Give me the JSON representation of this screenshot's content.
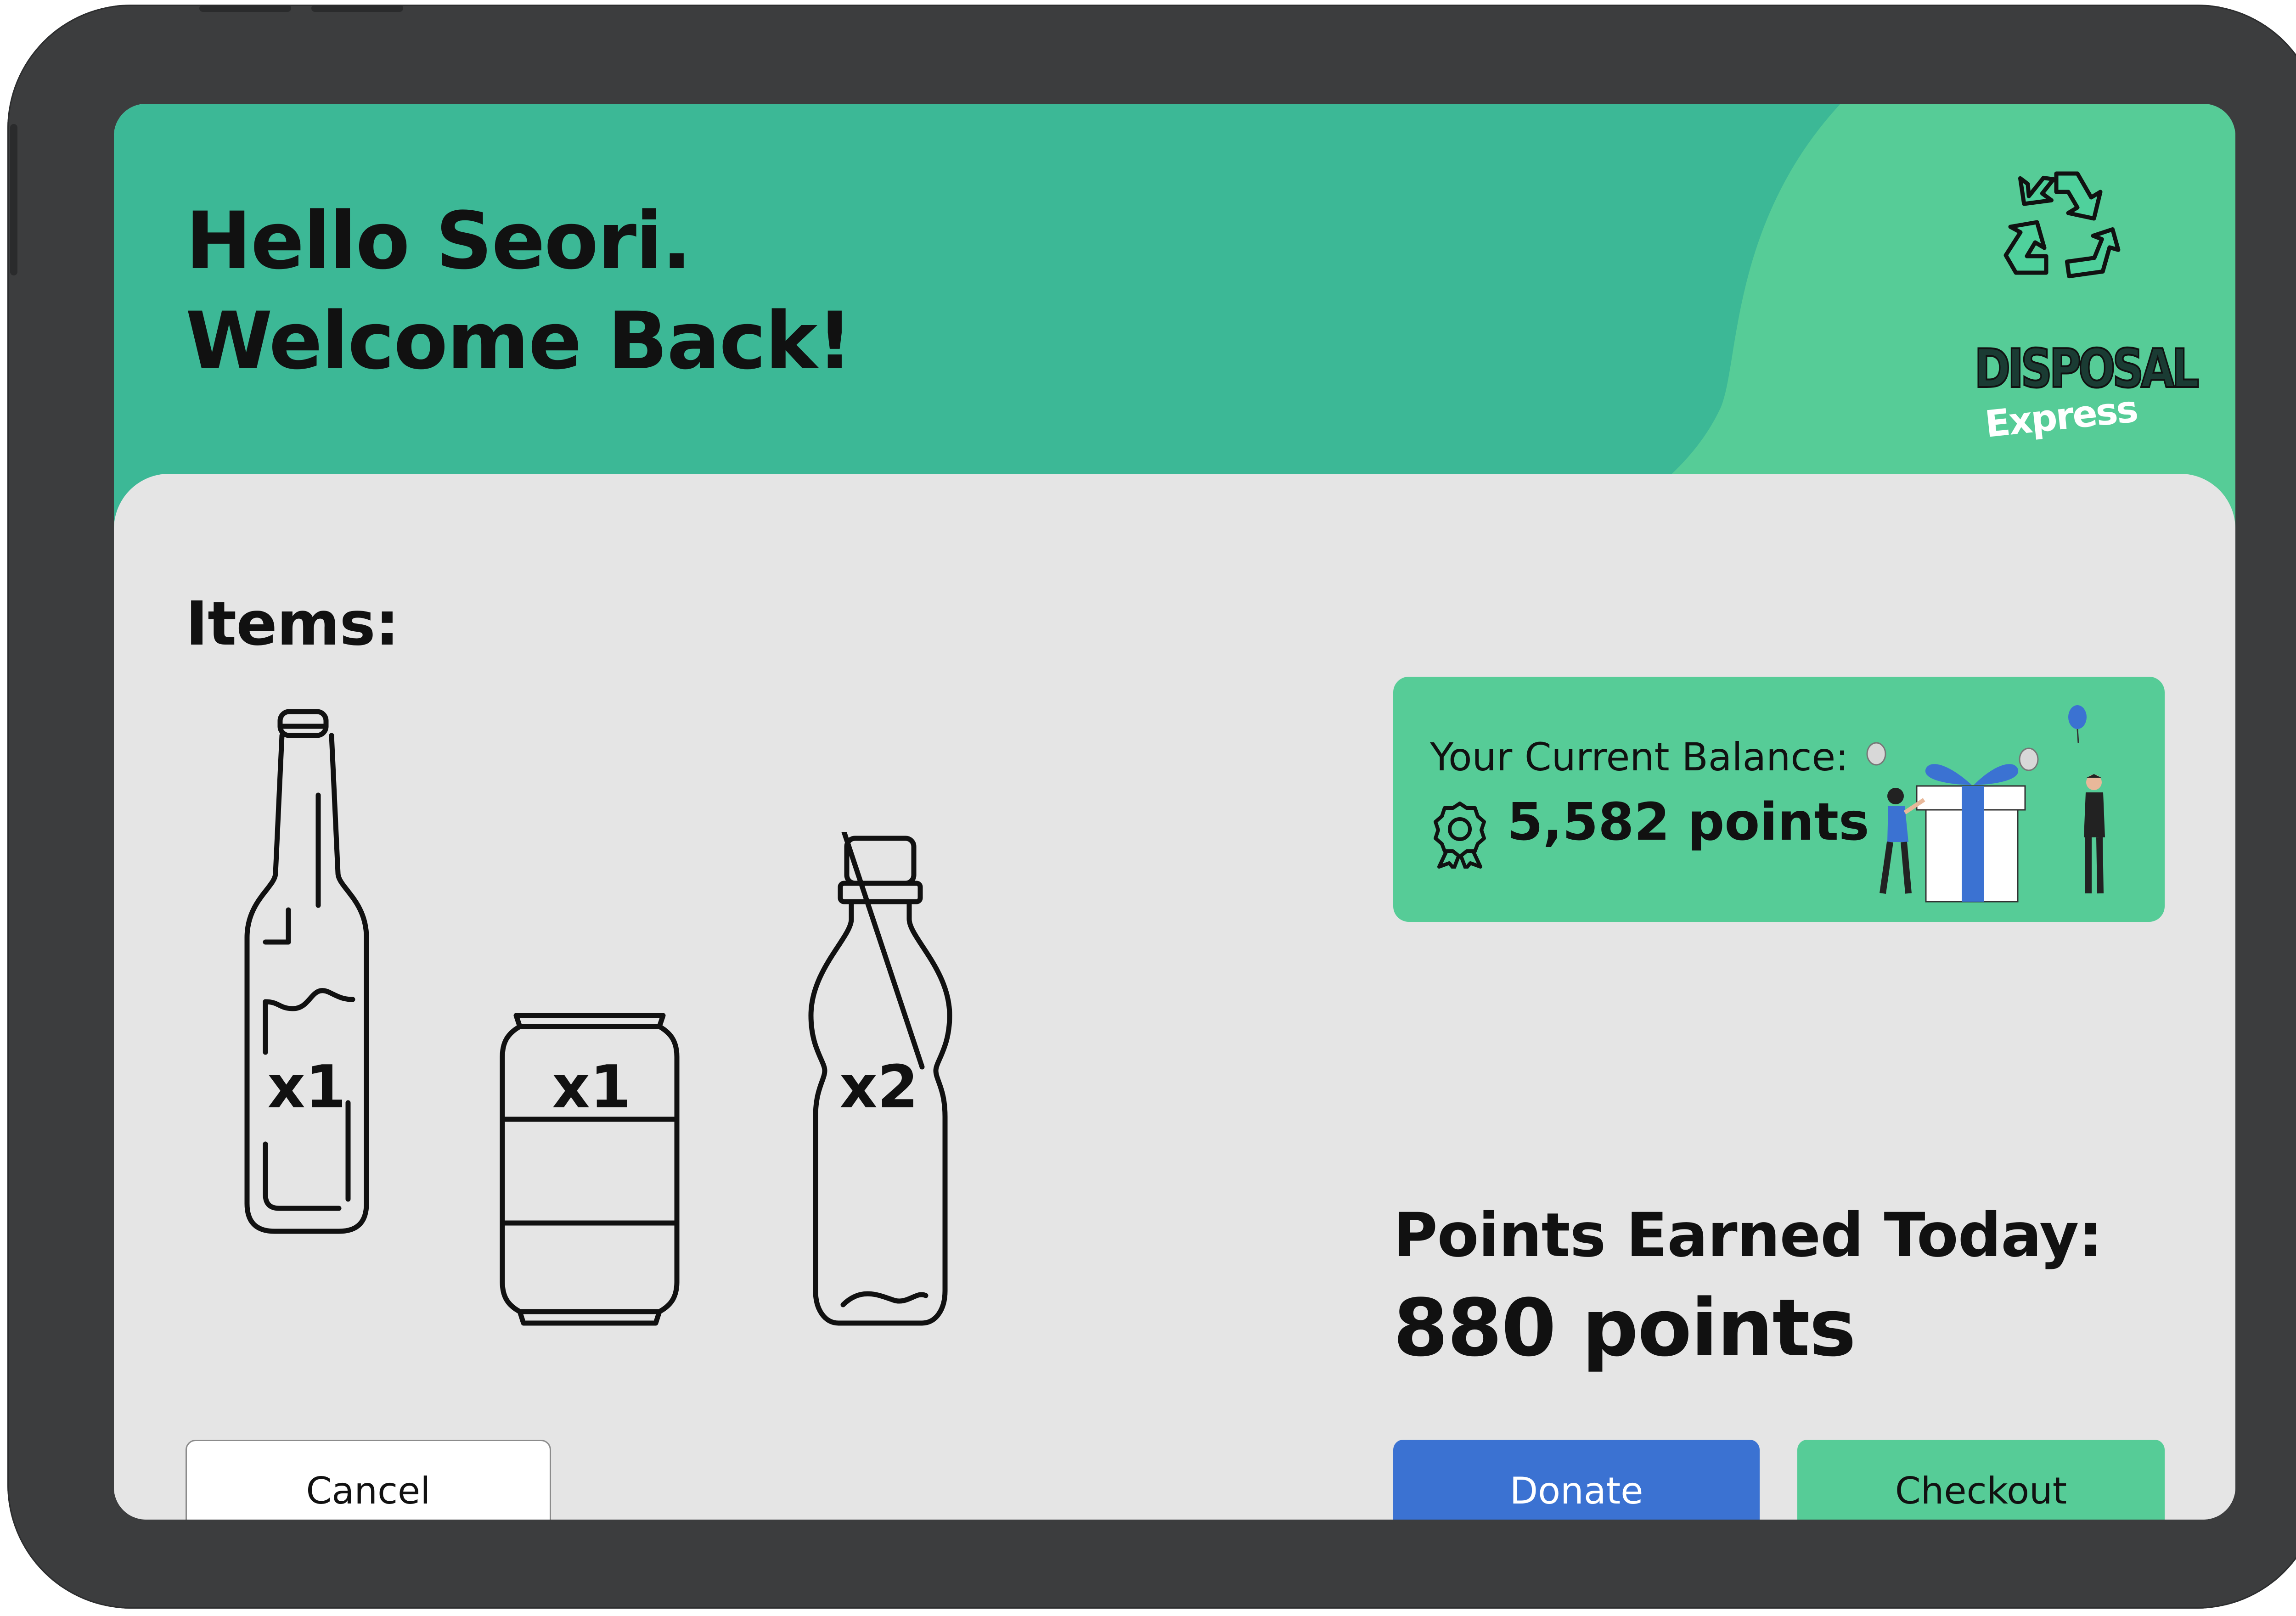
{
  "header": {
    "greeting_line1": "Hello Seori.",
    "greeting_line2": "Welcome Back!"
  },
  "logo": {
    "word": "DISPOSAL",
    "sub": "Express",
    "icon": "recycle-icon"
  },
  "items": {
    "title": "Items:",
    "list": [
      {
        "icon": "glass-bottle-icon",
        "quantity": "x1"
      },
      {
        "icon": "can-icon",
        "quantity": "x1"
      },
      {
        "icon": "plastic-bottle-icon",
        "quantity": "x2"
      }
    ]
  },
  "balance": {
    "label": "Your Current Balance:",
    "points": "5,582 points",
    "icon": "award-icon"
  },
  "earned": {
    "label": "Points Earned Today:",
    "points": "880 points"
  },
  "buttons": {
    "cancel": "Cancel",
    "donate": "Donate",
    "checkout": "Checkout"
  },
  "colors": {
    "header": "#3cb896",
    "accent_green": "#56cc97",
    "donate_blue": "#3b72d2",
    "bezel": "#3c3d3e",
    "panel": "#e5e5e5"
  }
}
